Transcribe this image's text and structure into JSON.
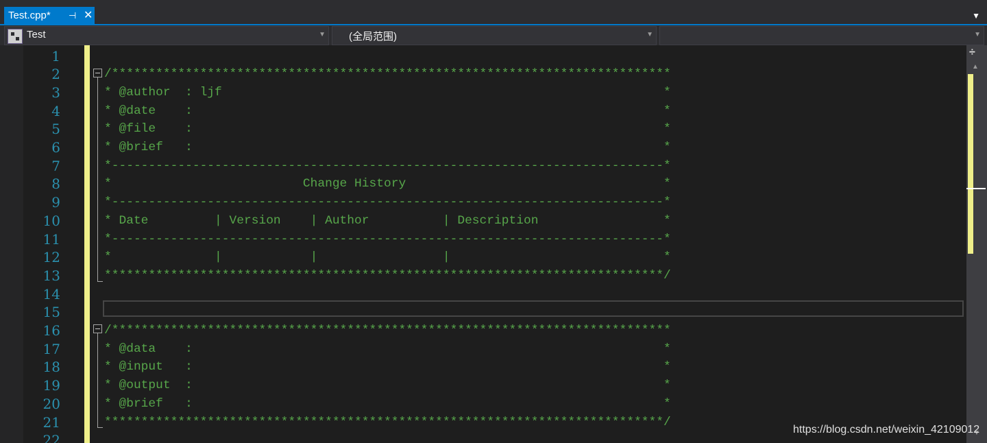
{
  "tab": {
    "title": "Test.cpp*",
    "pin_glyph": "⊣",
    "close_glyph": "✕"
  },
  "navbar": {
    "project": "Test",
    "scope": "(全局范围)",
    "member": ""
  },
  "editor": {
    "line_numbers": [
      "1",
      "2",
      "3",
      "4",
      "5",
      "6",
      "7",
      "8",
      "9",
      "10",
      "11",
      "12",
      "13",
      "14",
      "15",
      "16",
      "17",
      "18",
      "19",
      "20",
      "21",
      "22"
    ],
    "lines": [
      "",
      "/****************************************************************************",
      "* @author  : ljf                                                            *",
      "* @date    :                                                                *",
      "* @file    :                                                                *",
      "* @brief   :                                                                *",
      "*---------------------------------------------------------------------------*",
      "*                          Change History                                   *",
      "*---------------------------------------------------------------------------*",
      "* Date         | Version    | Author          | Description                 *",
      "*---------------------------------------------------------------------------*",
      "*              |            |                 |                             *",
      "****************************************************************************/",
      "",
      "",
      "/****************************************************************************",
      "* @data    :                                                                *",
      "* @input   :                                                                *",
      "* @output  :                                                                *",
      "* @brief   :                                                                *",
      "****************************************************************************/",
      ""
    ]
  },
  "watermark": "https://blog.csdn.net/weixin_42109012"
}
